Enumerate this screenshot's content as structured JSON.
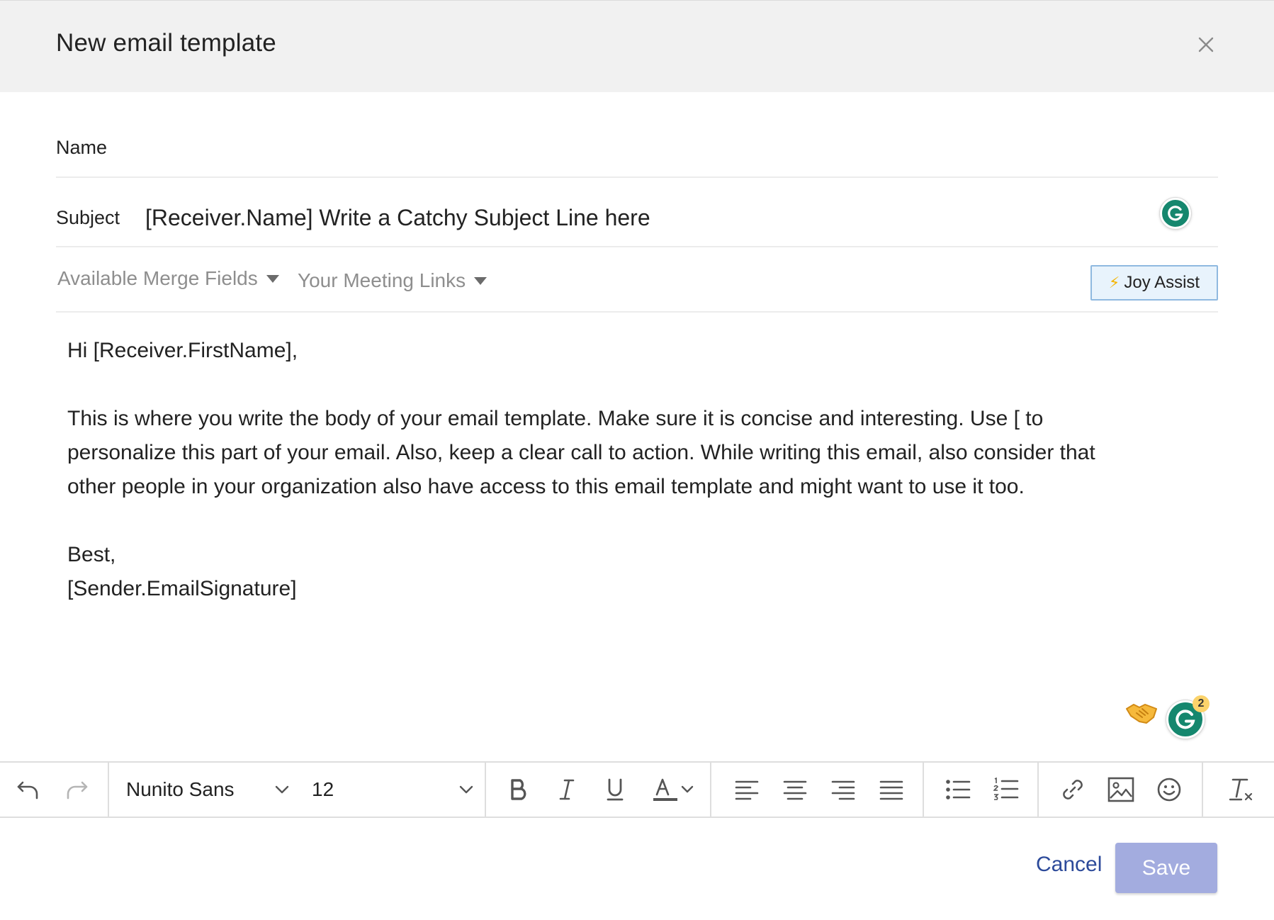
{
  "header": {
    "title": "New email template"
  },
  "form": {
    "name_label": "Name",
    "subject_label": "Subject",
    "subject_value": "[Receiver.Name] Write a Catchy Subject Line here"
  },
  "merge_bar": {
    "merge_fields_label": "Available Merge Fields",
    "meeting_links_label": "Your Meeting Links",
    "joy_assist_label": "Joy Assist"
  },
  "body": {
    "greeting": "Hi [Receiver.FirstName],",
    "paragraph_lines": [
      "This is where you write the body of your email template. Make sure it is concise and interesting. Use [ to",
      "personalize this part of your email. Also, keep a clear call to action. While writing this email, also consider that",
      "other people in your organization also have access to this email template and might want to use it too."
    ],
    "signoff": "Best,",
    "signature": "[Sender.EmailSignature]"
  },
  "grammarly": {
    "suggestion_count": "2"
  },
  "toolbar": {
    "font_family": "Nunito Sans",
    "font_size": "12",
    "icons": [
      "undo-icon",
      "redo-icon",
      "bold-icon",
      "italic-icon",
      "underline-icon",
      "text-color-icon",
      "align-left-icon",
      "align-center-icon",
      "align-right-icon",
      "align-justify-icon",
      "bullet-list-icon",
      "numbered-list-icon",
      "link-icon",
      "image-icon",
      "emoji-icon",
      "clear-format-icon"
    ]
  },
  "footer": {
    "cancel_label": "Cancel",
    "save_label": "Save"
  },
  "colors": {
    "header_bg": "#f1f1f1",
    "cancel_link": "#2c4a9a",
    "save_button": "#a3acdf",
    "joy_assist_bg": "#e8f3fc",
    "grammarly_green": "#15876e"
  }
}
